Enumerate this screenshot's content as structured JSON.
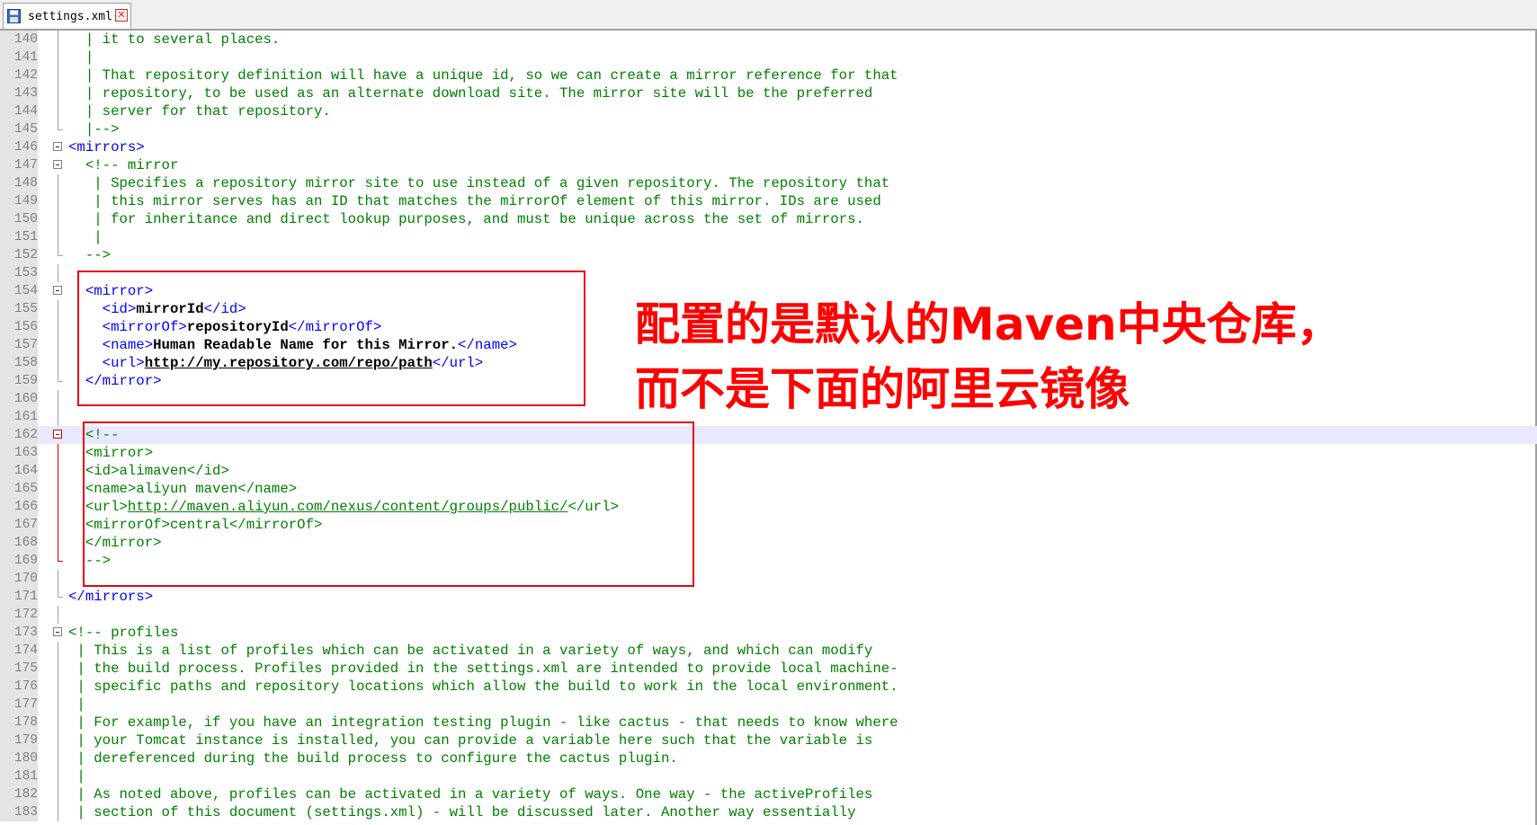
{
  "tab": {
    "filename": "settings.xml",
    "close_symbol": "✕"
  },
  "annotation": {
    "line1": "配置的是默认的Maven中央仓库，",
    "line2": "而不是下面的阿里云镜像"
  },
  "lines": [
    {
      "n": "140",
      "fold": "line",
      "parts": [
        [
          "comment",
          "  | it to several places."
        ]
      ]
    },
    {
      "n": "141",
      "fold": "line",
      "parts": [
        [
          "comment",
          "  |"
        ]
      ]
    },
    {
      "n": "142",
      "fold": "line",
      "parts": [
        [
          "comment",
          "  | That repository definition will have a unique id, so we can create a mirror reference for that"
        ]
      ]
    },
    {
      "n": "143",
      "fold": "line",
      "parts": [
        [
          "comment",
          "  | repository, to be used as an alternate download site. The mirror site will be the preferred"
        ]
      ]
    },
    {
      "n": "144",
      "fold": "line",
      "parts": [
        [
          "comment",
          "  | server for that repository."
        ]
      ]
    },
    {
      "n": "145",
      "fold": "end",
      "parts": [
        [
          "comment",
          "  |-->"
        ]
      ]
    },
    {
      "n": "146",
      "fold": "box",
      "parts": [
        [
          "tag",
          "<mirrors>"
        ]
      ]
    },
    {
      "n": "147",
      "fold": "box",
      "parts": [
        [
          "comment",
          "  <!-- mirror"
        ]
      ]
    },
    {
      "n": "148",
      "fold": "line",
      "parts": [
        [
          "comment",
          "   | Specifies a repository mirror site to use instead of a given repository. The repository that"
        ]
      ]
    },
    {
      "n": "149",
      "fold": "line",
      "parts": [
        [
          "comment",
          "   | this mirror serves has an ID that matches the mirrorOf element of this mirror. IDs are used"
        ]
      ]
    },
    {
      "n": "150",
      "fold": "line",
      "parts": [
        [
          "comment",
          "   | for inheritance and direct lookup purposes, and must be unique across the set of mirrors."
        ]
      ]
    },
    {
      "n": "151",
      "fold": "line",
      "parts": [
        [
          "comment",
          "   |"
        ]
      ]
    },
    {
      "n": "152",
      "fold": "end",
      "parts": [
        [
          "comment",
          "  -->"
        ]
      ]
    },
    {
      "n": "153",
      "fold": "line",
      "parts": []
    },
    {
      "n": "154",
      "fold": "box",
      "parts": [
        [
          "tag",
          "  <mirror>"
        ]
      ]
    },
    {
      "n": "155",
      "fold": "line",
      "parts": [
        [
          "tag",
          "    <id>"
        ],
        [
          "text",
          "mirrorId"
        ],
        [
          "tag",
          "</id>"
        ]
      ]
    },
    {
      "n": "156",
      "fold": "line",
      "parts": [
        [
          "tag",
          "    <mirrorOf>"
        ],
        [
          "text",
          "repositoryId"
        ],
        [
          "tag",
          "</mirrorOf>"
        ]
      ]
    },
    {
      "n": "157",
      "fold": "line",
      "parts": [
        [
          "tag",
          "    <name>"
        ],
        [
          "text",
          "Human Readable Name for this Mirror."
        ],
        [
          "tag",
          "</name>"
        ]
      ]
    },
    {
      "n": "158",
      "fold": "line",
      "parts": [
        [
          "tag",
          "    <url>"
        ],
        [
          "link",
          "http://my.repository.com/repo/path"
        ],
        [
          "tag",
          "</url>"
        ]
      ]
    },
    {
      "n": "159",
      "fold": "end",
      "parts": [
        [
          "tag",
          "  </mirror>"
        ]
      ]
    },
    {
      "n": "160",
      "fold": "line",
      "parts": []
    },
    {
      "n": "161",
      "fold": "line",
      "parts": []
    },
    {
      "n": "162",
      "fold": "redbox",
      "highlight": true,
      "parts": [
        [
          "comment",
          "  <!--"
        ]
      ]
    },
    {
      "n": "163",
      "fold": "redline",
      "parts": [
        [
          "comment",
          "  <mirror>"
        ]
      ]
    },
    {
      "n": "164",
      "fold": "redline",
      "parts": [
        [
          "comment",
          "  <id>alimaven</id>"
        ]
      ]
    },
    {
      "n": "165",
      "fold": "redline",
      "parts": [
        [
          "comment",
          "  <name>aliyun maven</name>"
        ]
      ]
    },
    {
      "n": "166",
      "fold": "redline",
      "parts": [
        [
          "comment",
          "  <url>"
        ],
        [
          "clink",
          "http://maven.aliyun.com/nexus/content/groups/public/"
        ],
        [
          "comment",
          "</url>"
        ]
      ]
    },
    {
      "n": "167",
      "fold": "redline",
      "parts": [
        [
          "comment",
          "  <mirrorOf>central</mirrorOf>"
        ]
      ]
    },
    {
      "n": "168",
      "fold": "redline",
      "parts": [
        [
          "comment",
          "  </mirror>"
        ]
      ]
    },
    {
      "n": "169",
      "fold": "redend",
      "parts": [
        [
          "comment",
          "  -->"
        ]
      ]
    },
    {
      "n": "170",
      "fold": "line",
      "parts": []
    },
    {
      "n": "171",
      "fold": "end",
      "parts": [
        [
          "tag",
          "</mirrors>"
        ]
      ]
    },
    {
      "n": "172",
      "fold": "line",
      "parts": []
    },
    {
      "n": "173",
      "fold": "box",
      "parts": [
        [
          "comment",
          "<!-- profiles"
        ]
      ]
    },
    {
      "n": "174",
      "fold": "line",
      "parts": [
        [
          "comment",
          " | This is a list of profiles which can be activated in a variety of ways, and which can modify"
        ]
      ]
    },
    {
      "n": "175",
      "fold": "line",
      "parts": [
        [
          "comment",
          " | the build process. Profiles provided in the settings.xml are intended to provide local machine-"
        ]
      ]
    },
    {
      "n": "176",
      "fold": "line",
      "parts": [
        [
          "comment",
          " | specific paths and repository locations which allow the build to work in the local environment."
        ]
      ]
    },
    {
      "n": "177",
      "fold": "line",
      "parts": [
        [
          "comment",
          " |"
        ]
      ]
    },
    {
      "n": "178",
      "fold": "line",
      "parts": [
        [
          "comment",
          " | For example, if you have an integration testing plugin - like cactus - that needs to know where"
        ]
      ]
    },
    {
      "n": "179",
      "fold": "line",
      "parts": [
        [
          "comment",
          " | your Tomcat instance is installed, you can provide a variable here such that the variable is"
        ]
      ]
    },
    {
      "n": "180",
      "fold": "line",
      "parts": [
        [
          "comment",
          " | dereferenced during the build process to configure the cactus plugin."
        ]
      ]
    },
    {
      "n": "181",
      "fold": "line",
      "parts": [
        [
          "comment",
          " |"
        ]
      ]
    },
    {
      "n": "182",
      "fold": "line",
      "parts": [
        [
          "comment",
          " | As noted above, profiles can be activated in a variety of ways. One way - the activeProfiles"
        ]
      ]
    },
    {
      "n": "183",
      "fold": "line",
      "parts": [
        [
          "comment",
          " | section of this document (settings.xml) - will be discussed later. Another way essentially"
        ]
      ]
    }
  ]
}
